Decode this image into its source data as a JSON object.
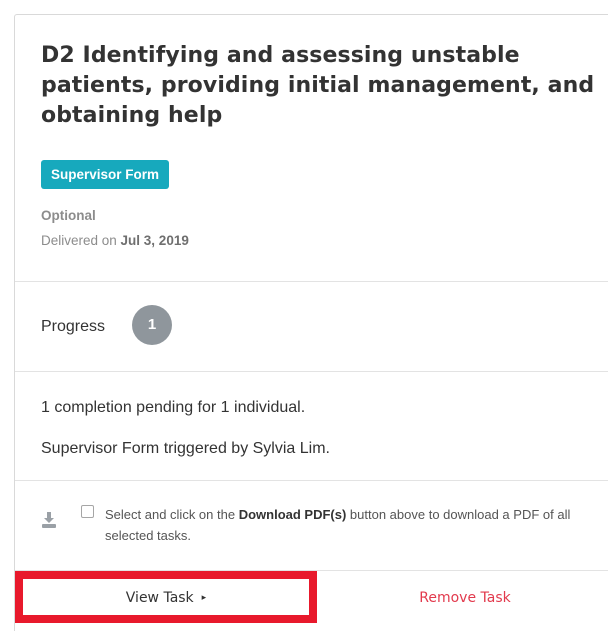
{
  "task": {
    "title": "D2 Identifying and assessing unstable patients, providing initial management, and obtaining help",
    "badge": "Supervisor Form",
    "optional": "Optional",
    "delivered_prefix": "Delivered on ",
    "delivered_date": "Jul 3, 2019"
  },
  "progress": {
    "label": "Progress",
    "count": "1"
  },
  "status": {
    "pending": "1 completion pending for 1 individual.",
    "triggered": "Supervisor Form triggered by Sylvia Lim."
  },
  "download": {
    "text_before": "Select and click on the ",
    "button_ref": "Download PDF(s)",
    "text_after": " button above to download a PDF of all selected tasks.",
    "icon": "download-icon"
  },
  "actions": {
    "view_task": "View Task",
    "view_task_caret": "▸",
    "remove_task": "Remove Task"
  },
  "colors": {
    "badge": "#17a9bd",
    "progress_circle": "#8f969c",
    "highlight": "#e8192c",
    "remove": "#e23a4d"
  }
}
